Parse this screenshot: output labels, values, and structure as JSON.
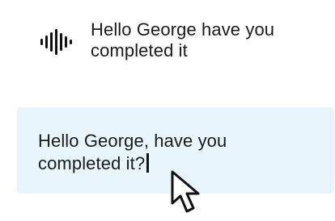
{
  "transcript": {
    "icon": "waveform-icon",
    "text": "Hello George have you completed it"
  },
  "editor": {
    "text": "Hello George, have you completed it?",
    "background": "#e9f5fd"
  },
  "cursor": {
    "icon": "mouse-pointer-icon"
  }
}
